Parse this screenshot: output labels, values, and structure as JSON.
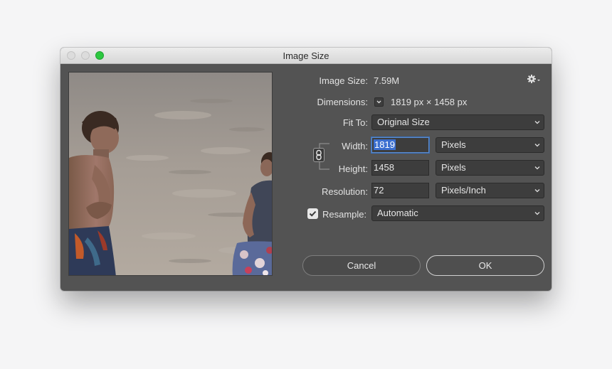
{
  "window": {
    "title": "Image Size"
  },
  "info": {
    "image_size_label": "Image Size:",
    "image_size_value": "7.59M",
    "dimensions_label": "Dimensions:",
    "dimensions_value": "1819 px  ×  1458 px"
  },
  "fields": {
    "fit_to_label": "Fit To:",
    "fit_to_value": "Original Size",
    "width_label": "Width:",
    "width_value": "1819",
    "width_unit": "Pixels",
    "height_label": "Height:",
    "height_value": "1458",
    "height_unit": "Pixels",
    "resolution_label": "Resolution:",
    "resolution_value": "72",
    "resolution_unit": "Pixels/Inch",
    "resample_label": "Resample:",
    "resample_checked": true,
    "resample_value": "Automatic"
  },
  "buttons": {
    "cancel": "Cancel",
    "ok": "OK"
  },
  "colors": {
    "dialog_bg": "#535353",
    "field_bg": "#3d3d3d",
    "selection": "#3b6fd0",
    "zoom_button": "#2dc840"
  },
  "icons": {
    "settings": "gear-icon",
    "link": "chain-link-icon",
    "dimensions_menu": "chevron-down-icon"
  }
}
